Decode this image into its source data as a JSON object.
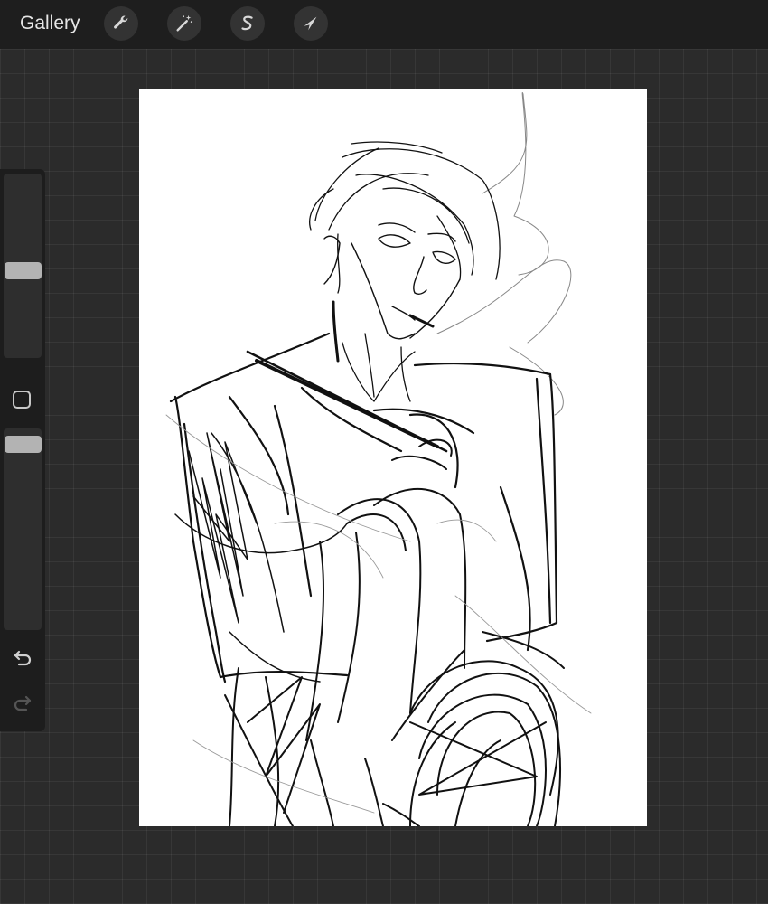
{
  "topbar": {
    "gallery_label": "Gallery",
    "tools": [
      {
        "name": "actions",
        "icon": "wrench-icon"
      },
      {
        "name": "adjustments",
        "icon": "magic-wand-icon"
      },
      {
        "name": "selection",
        "icon": "selection-s-icon"
      },
      {
        "name": "transform",
        "icon": "arrow-cursor-icon"
      }
    ]
  },
  "sidebar": {
    "brush_size_level": 0.47,
    "opacity_level": 0.96,
    "modify_button_icon": "square-icon",
    "undo_icon": "undo-icon",
    "redo_icon": "redo-icon",
    "redo_enabled": false
  },
  "canvas": {
    "content": "sketch-artwork"
  },
  "colors": {
    "topbar_bg": "#1e1e1e",
    "workspace_bg": "#2b2b2b",
    "canvas_bg": "#ffffff",
    "slider_thumb": "#b3b3b3"
  }
}
